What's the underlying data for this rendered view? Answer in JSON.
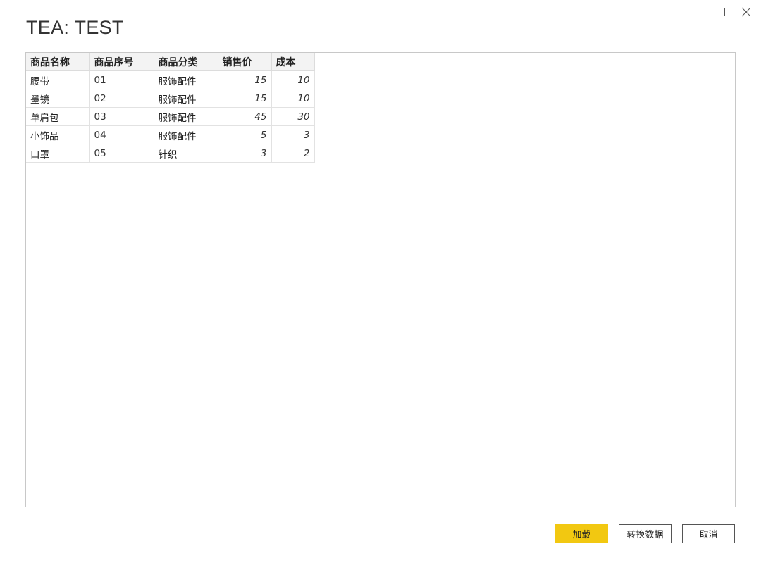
{
  "dialog": {
    "title": "TEA: TEST"
  },
  "window_controls": {
    "maximize_icon": "maximize-icon",
    "close_icon": "close-icon"
  },
  "table": {
    "columns": [
      "商品名称",
      "商品序号",
      "商品分类",
      "销售价",
      "成本"
    ],
    "rows": [
      [
        "腰带",
        "01",
        "服饰配件",
        "15",
        "10"
      ],
      [
        "墨镜",
        "02",
        "服饰配件",
        "15",
        "10"
      ],
      [
        "单肩包",
        "03",
        "服饰配件",
        "45",
        "30"
      ],
      [
        "小饰品",
        "04",
        "服饰配件",
        "5",
        "3"
      ],
      [
        "口罩",
        "05",
        "针织",
        "3",
        "2"
      ]
    ]
  },
  "footer": {
    "load_label": "加载",
    "transform_label": "转换数据",
    "cancel_label": "取消"
  },
  "colors": {
    "accent": "#f2c811",
    "border": "#c8c8c8"
  }
}
